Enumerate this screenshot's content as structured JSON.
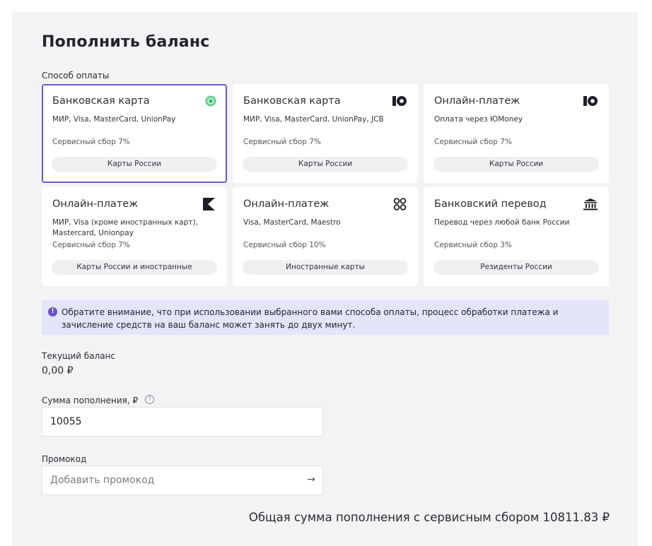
{
  "page": {
    "title": "Пополнить баланс",
    "payment_method_label": "Способ оплаты"
  },
  "payment_methods": [
    {
      "title": "Банковская карта",
      "icon": "green-circle-icon",
      "description": "МИР, Visa, MasterCard, UnionPay",
      "fee": "Сервисный сбор 7%",
      "tag": "Карты России",
      "selected": true
    },
    {
      "title": "Банковская карта",
      "icon": "yoomoney-icon",
      "description": "МИР, Visa, MasterCard, UnionPay, JCB",
      "fee": "Сервисный сбор 7%",
      "tag": "Карты России",
      "selected": false
    },
    {
      "title": "Онлайн-платеж",
      "icon": "yoomoney-icon",
      "description": "Оплата через ЮMoney",
      "fee": "Сервисный сбор 7%",
      "tag": "Карты России",
      "selected": false
    },
    {
      "title": "Онлайн-платеж",
      "icon": "k-logo-icon",
      "description": "МИР, Visa (кроме иностранных карт), Mastercard, Unionpay",
      "fee": "Сервисный сбор 7%",
      "tag": "Карты России и иностранные",
      "selected": false
    },
    {
      "title": "Онлайн-платеж",
      "icon": "four-dots-icon",
      "description": "Visa, MasterCard, Maestro",
      "fee": "Сервисный сбор 10%",
      "tag": "Иностранные карты",
      "selected": false
    },
    {
      "title": "Банковский перевод",
      "icon": "bank-icon",
      "description": "Перевод через любой банк России",
      "fee": "Сервисный сбор 3%",
      "tag": "Резиденты России",
      "selected": false
    }
  ],
  "notice": {
    "icon": "exclamation-icon",
    "text": "Обратите внимание, что при использовании выбранного вами способа оплаты, процесс обработки платежа и зачисление средств на ваш баланс может занять до двух минут."
  },
  "balance": {
    "label": "Текущий баланс",
    "value": "0,00 ₽"
  },
  "amount": {
    "label": "Сумма пополнения, ₽",
    "help_icon": "question-icon",
    "value": "10055"
  },
  "promo": {
    "label": "Промокод",
    "placeholder": "Добавить промокод",
    "submit_icon": "arrow-right-icon",
    "submit_glyph": "→"
  },
  "total": {
    "text": "Общая сумма пополнения с сервисным сбором 10811.83 ₽"
  },
  "colors": {
    "selected_border": "#6c5cc8",
    "notice_bg": "#e4e4fa",
    "notice_icon": "#6b4fd0",
    "panel_bg": "#f3f3f5"
  }
}
